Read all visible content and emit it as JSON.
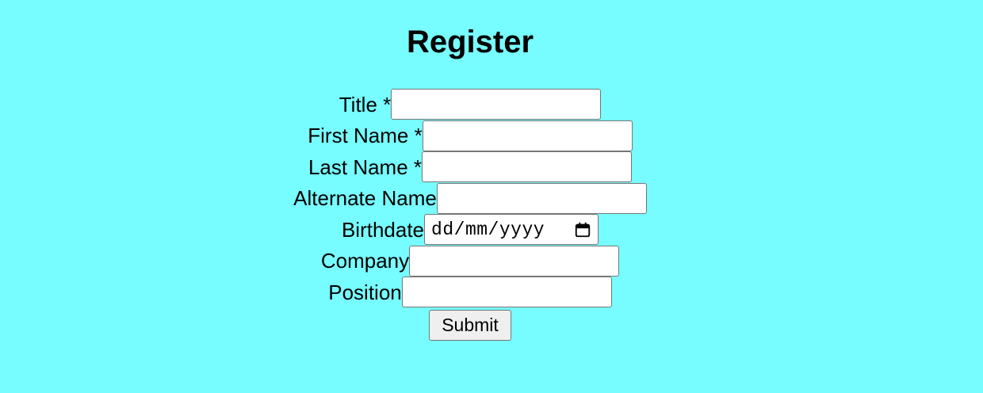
{
  "page": {
    "title": "Register",
    "background": "#77fcff"
  },
  "form": {
    "fields": [
      {
        "label": "Title *",
        "value": ""
      },
      {
        "label": "First Name *",
        "value": ""
      },
      {
        "label": "Last Name *",
        "value": ""
      },
      {
        "label": "Alternate Name",
        "value": ""
      },
      {
        "label": "Birthdate",
        "placeholder": "dd/mm/yyyy",
        "icon": "calendar-icon"
      },
      {
        "label": "Company",
        "value": ""
      },
      {
        "label": "Position",
        "value": ""
      }
    ],
    "submit_label": "Submit"
  }
}
